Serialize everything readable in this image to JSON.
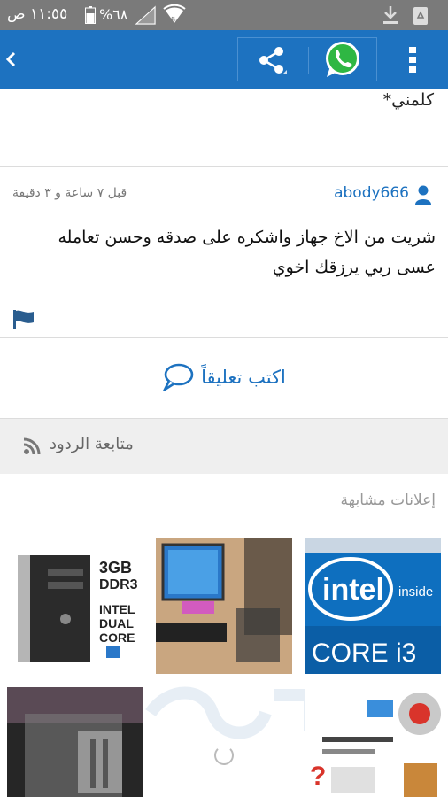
{
  "status_bar": {
    "time": "١١:٥٥ ص",
    "battery": "%٦٨"
  },
  "toolbar": {
    "back_icon": "chevron-left-icon",
    "share_icon": "share-icon",
    "whatsapp_icon": "whatsapp-icon",
    "menu_icon": "overflow-menu-icon",
    "accent": "#1d72c0"
  },
  "previous_comment": {
    "text": "كلمني*"
  },
  "comment": {
    "username": "abody666",
    "time_ago": "قبل ٧ ساعة و ٣ دقيقة",
    "body": "شريت من الاخ جهاز واشكره على صدقه وحسن تعامله عسى ربي يرزقك اخوي"
  },
  "write_comment": {
    "label": "اكتب تعليقاً"
  },
  "follow": {
    "label": "متابعة الردود"
  },
  "similar_ads": {
    "title": "إعلانات مشابهة",
    "items": [
      {
        "name": "intel-core-i3-ad",
        "brand": "intel",
        "brand_suffix": "inside",
        "product": "CORE i3"
      },
      {
        "name": "desktop-setup-ad"
      },
      {
        "name": "compaq-pc-ad",
        "spec1": "3GB",
        "spec2": "DDR3",
        "spec3": "INTEL",
        "spec4": "DUAL",
        "spec5": "CORE"
      },
      {
        "name": "repair-services-ad"
      },
      {
        "name": "empty-slot"
      },
      {
        "name": "server-hardware-ad"
      }
    ]
  }
}
